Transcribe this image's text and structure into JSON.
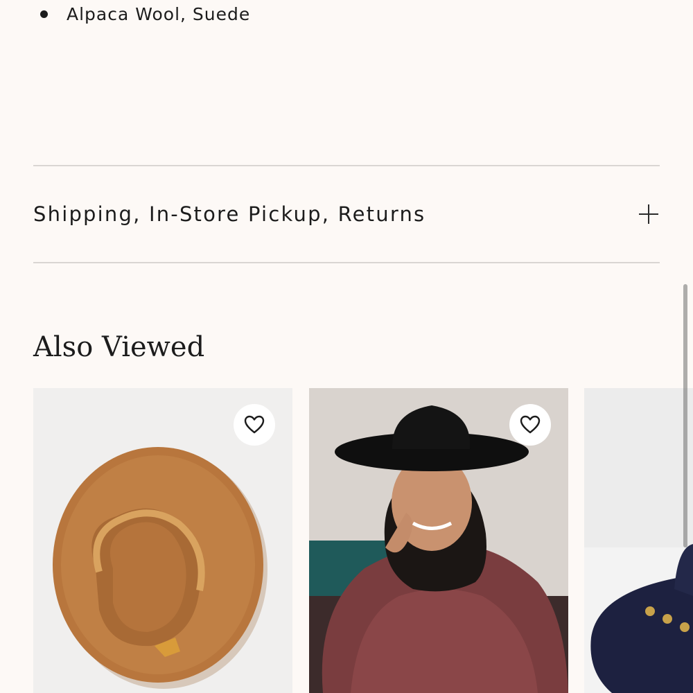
{
  "details": {
    "materials": [
      "Alpaca Wool, Suede"
    ]
  },
  "accordion": {
    "shipping_label": "Shipping, In-Store Pickup, Returns"
  },
  "also_viewed": {
    "title": "Also Viewed",
    "products": [
      {
        "image": "tan-wide-brim-hat"
      },
      {
        "image": "model-in-black-hat"
      },
      {
        "image": "navy-hat-with-charms"
      }
    ]
  },
  "colors": {
    "background": "#fdf9f6",
    "text": "#1c1c1c",
    "divider": "#d9d5d2"
  }
}
